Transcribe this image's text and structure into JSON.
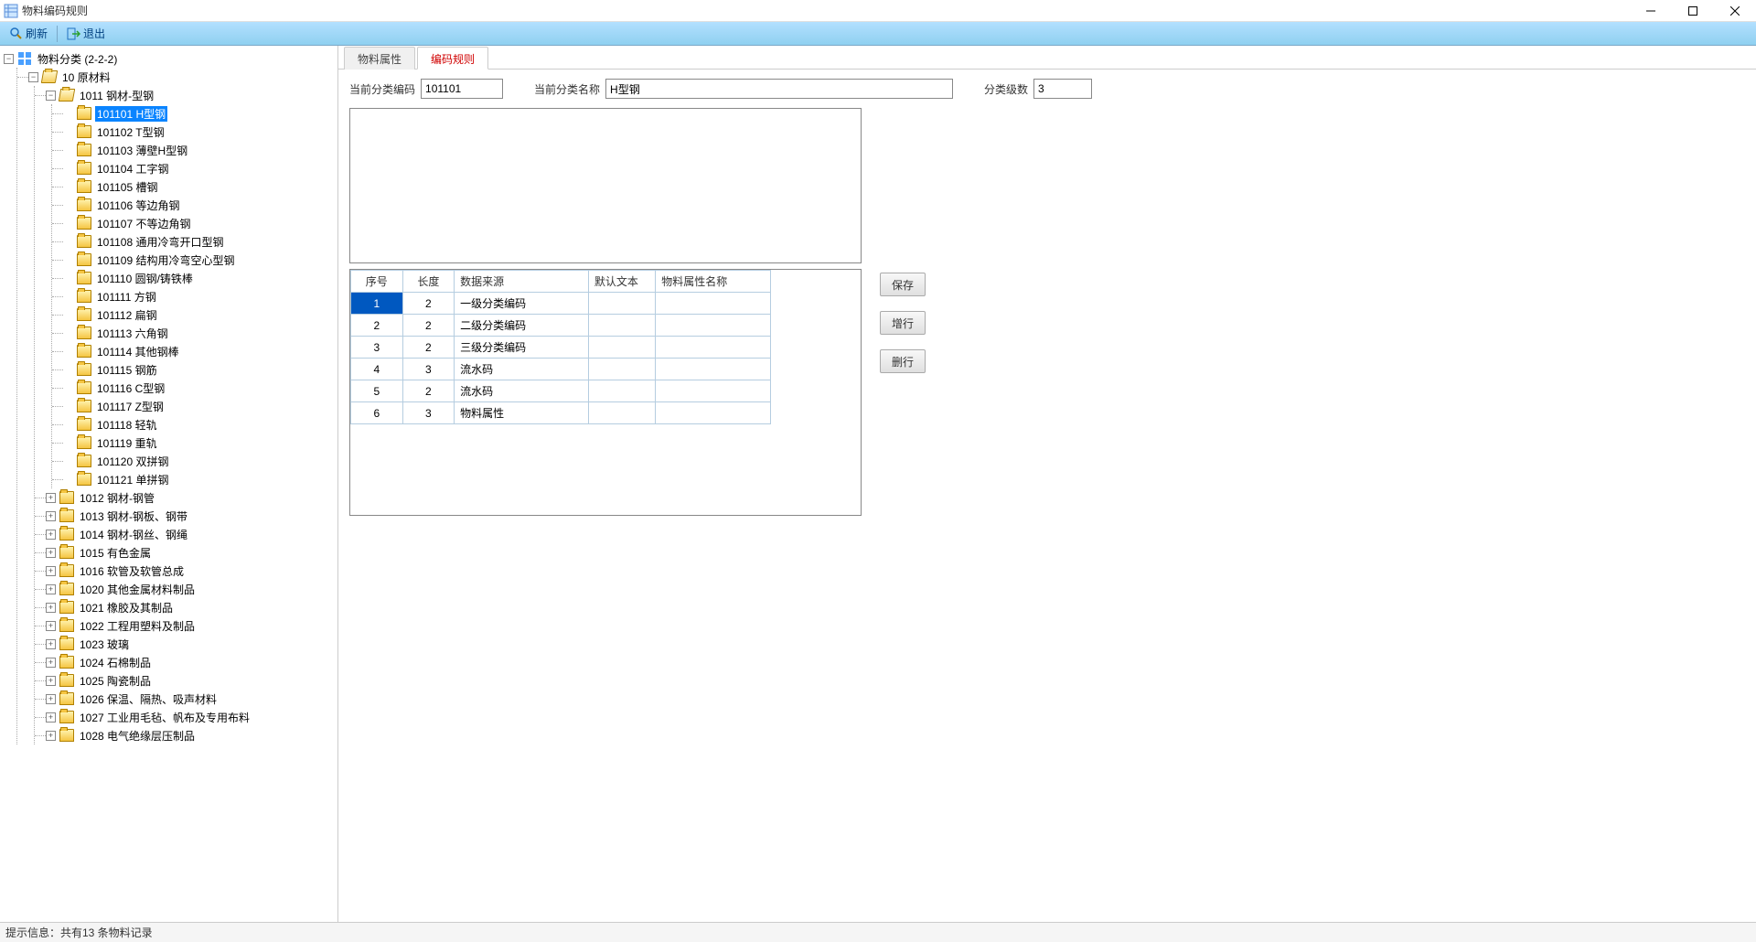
{
  "window": {
    "title": "物料编码规则"
  },
  "toolbar": {
    "refresh": "刷新",
    "exit": "退出"
  },
  "tree": {
    "root_label": "物料分类 (2-2-2)",
    "level1": {
      "code": "10",
      "label": "原材料"
    },
    "level2": {
      "code": "1011",
      "label": "钢材-型钢"
    },
    "leaves": [
      {
        "code": "101101",
        "label": "H型钢",
        "selected": true
      },
      {
        "code": "101102",
        "label": "T型钢"
      },
      {
        "code": "101103",
        "label": "薄壁H型钢"
      },
      {
        "code": "101104",
        "label": "工字钢"
      },
      {
        "code": "101105",
        "label": "槽钢"
      },
      {
        "code": "101106",
        "label": "等边角钢"
      },
      {
        "code": "101107",
        "label": "不等边角钢"
      },
      {
        "code": "101108",
        "label": "通用冷弯开口型钢"
      },
      {
        "code": "101109",
        "label": "结构用冷弯空心型钢"
      },
      {
        "code": "101110",
        "label": "圆钢/铸铁棒"
      },
      {
        "code": "101111",
        "label": "方钢"
      },
      {
        "code": "101112",
        "label": "扁钢"
      },
      {
        "code": "101113",
        "label": "六角钢"
      },
      {
        "code": "101114",
        "label": "其他钢棒"
      },
      {
        "code": "101115",
        "label": "钢筋"
      },
      {
        "code": "101116",
        "label": "C型钢"
      },
      {
        "code": "101117",
        "label": "Z型钢"
      },
      {
        "code": "101118",
        "label": "轻轨"
      },
      {
        "code": "101119",
        "label": "重轨"
      },
      {
        "code": "101120",
        "label": "双拼钢"
      },
      {
        "code": "101121",
        "label": "单拼钢"
      }
    ],
    "siblings": [
      {
        "code": "1012",
        "label": "钢材-钢管"
      },
      {
        "code": "1013",
        "label": "钢材-钢板、钢带"
      },
      {
        "code": "1014",
        "label": "钢材-钢丝、钢绳"
      },
      {
        "code": "1015",
        "label": "有色金属"
      },
      {
        "code": "1016",
        "label": "软管及软管总成"
      },
      {
        "code": "1020",
        "label": "其他金属材料制品"
      },
      {
        "code": "1021",
        "label": "橡胶及其制品"
      },
      {
        "code": "1022",
        "label": "工程用塑料及制品"
      },
      {
        "code": "1023",
        "label": "玻璃"
      },
      {
        "code": "1024",
        "label": "石棉制品"
      },
      {
        "code": "1025",
        "label": "陶瓷制品"
      },
      {
        "code": "1026",
        "label": "保温、隔热、吸声材料"
      },
      {
        "code": "1027",
        "label": "工业用毛毡、帆布及专用布料"
      },
      {
        "code": "1028",
        "label": "电气绝缘层压制品"
      }
    ]
  },
  "tabs": {
    "attr": "物料属性",
    "rule": "编码规则"
  },
  "form": {
    "code_label": "当前分类编码",
    "code_value": "101101",
    "name_label": "当前分类名称",
    "name_value": "H型钢",
    "level_label": "分类级数",
    "level_value": "3"
  },
  "grid": {
    "headers": {
      "seq": "序号",
      "len": "长度",
      "src": "数据来源",
      "def": "默认文本",
      "attr": "物料属性名称"
    },
    "rows": [
      {
        "seq": "1",
        "len": "2",
        "src": "一级分类编码",
        "def": "",
        "attr": "",
        "sel": true
      },
      {
        "seq": "2",
        "len": "2",
        "src": "二级分类编码",
        "def": "",
        "attr": ""
      },
      {
        "seq": "3",
        "len": "2",
        "src": "三级分类编码",
        "def": "",
        "attr": ""
      },
      {
        "seq": "4",
        "len": "3",
        "src": "流水码",
        "def": "",
        "attr": ""
      },
      {
        "seq": "5",
        "len": "2",
        "src": "流水码",
        "def": "",
        "attr": ""
      },
      {
        "seq": "6",
        "len": "3",
        "src": "物料属性",
        "def": "",
        "attr": ""
      }
    ]
  },
  "buttons": {
    "save": "保存",
    "addrow": "增行",
    "delrow": "删行"
  },
  "status": "提示信息：共有13 条物料记录"
}
